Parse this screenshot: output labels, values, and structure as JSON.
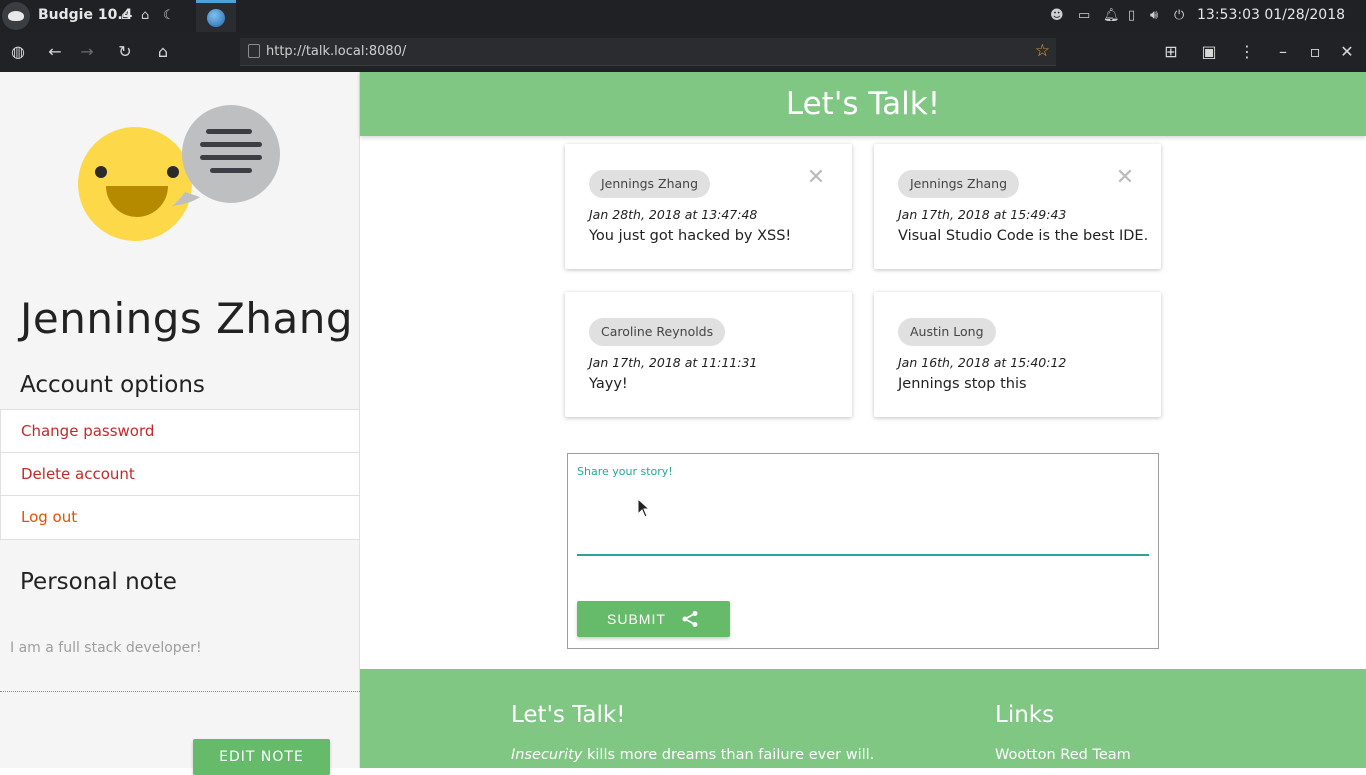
{
  "panel": {
    "os_title": "Budgie 10.4",
    "clock": "13:53:03 01/28/2018"
  },
  "browser": {
    "url": "http://talk.local:8080/"
  },
  "sidebar": {
    "user_name": "Jennings Zhang",
    "account_options_title": "Account options",
    "account_items": [
      {
        "label": "Change password"
      },
      {
        "label": "Delete account"
      },
      {
        "label": "Log out"
      }
    ],
    "personal_note_title": "Personal note",
    "personal_note_text": "I am a full stack developer!",
    "edit_note_label": "EDIT NOTE"
  },
  "header": {
    "title": "Let's Talk!"
  },
  "posts": [
    {
      "author": "Jennings Zhang",
      "date": "Jan 28th, 2018 at 13:47:48",
      "message": "You just got hacked by XSS!",
      "deletable": true
    },
    {
      "author": "Jennings Zhang",
      "date": "Jan 17th, 2018 at 15:49:43",
      "message": "Visual Studio Code is the best IDE.",
      "deletable": true
    },
    {
      "author": "Caroline Reynolds",
      "date": "Jan 17th, 2018 at 11:11:31",
      "message": "Yayy!",
      "deletable": false
    },
    {
      "author": "Austin Long",
      "date": "Jan 16th, 2018 at 15:40:12",
      "message": "Jennings stop this",
      "deletable": false
    }
  ],
  "story_form": {
    "label": "Share your story!",
    "value": "",
    "submit_label": "SUBMIT"
  },
  "footer": {
    "title": "Let's Talk!",
    "quote_emphasis": "Insecurity",
    "quote_rest": " kills more dreams than failure ever will.",
    "links_title": "Links",
    "link_1": "Wootton Red Team"
  },
  "colors": {
    "accent_green": "#81c784",
    "button_green": "#66bb6a",
    "teal": "#26a69a",
    "danger_red": "#c62828",
    "logout_orange": "#e65100"
  }
}
